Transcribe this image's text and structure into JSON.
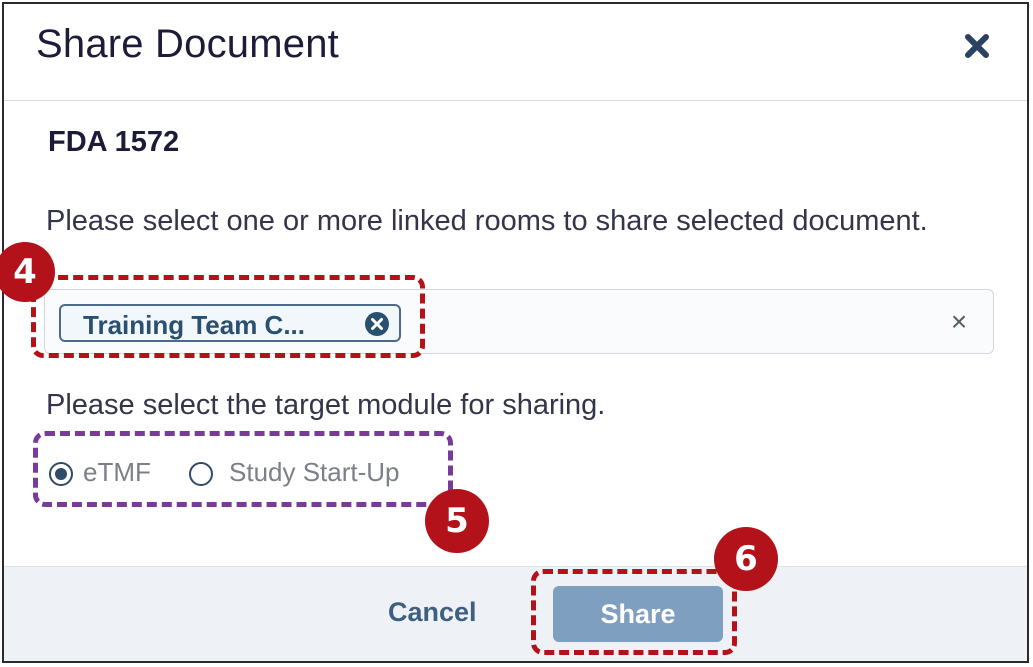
{
  "dialog": {
    "title": "Share Document",
    "close_icon": "close-icon",
    "document_name": "FDA 1572",
    "instructions": "Please select one or more linked rooms to share selected document.",
    "rooms_select": {
      "chips": [
        {
          "label": "Training Team C...",
          "remove_icon": "remove-circle-icon"
        }
      ],
      "clear_icon": "clear-icon",
      "clear_glyph": "×"
    },
    "module_prompt": "Please select the target module for sharing.",
    "modules": [
      {
        "label": "eTMF",
        "selected": true
      },
      {
        "label": "Study Start-Up",
        "selected": false
      }
    ]
  },
  "footer": {
    "cancel_label": "Cancel",
    "share_label": "Share"
  },
  "annotations": {
    "step_4": "4",
    "step_5": "5",
    "step_6": "6",
    "red_color": "#b3121a",
    "purple_color": "#7a3a9a"
  },
  "colors": {
    "title_text": "#1c1c3a",
    "chip_border": "#4d6a8a",
    "share_button": "#7f9fc0",
    "footer_bg": "#eef2f7"
  }
}
